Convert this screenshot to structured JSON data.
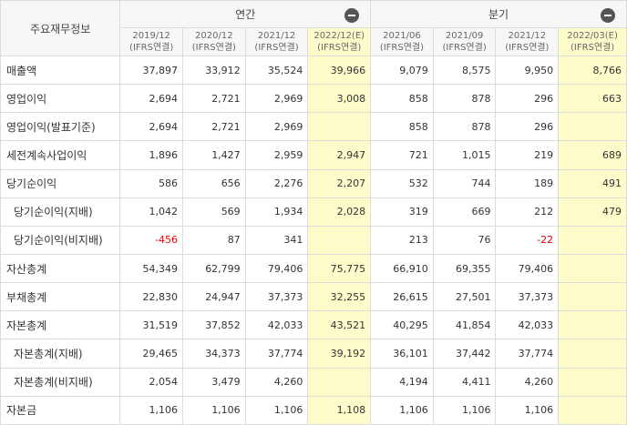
{
  "header": {
    "corner": "주요재무정보",
    "annual_label": "연간",
    "quarter_label": "분기",
    "annual_periods": [
      {
        "date": "2019/12",
        "basis": "(IFRS연결)",
        "estimate": false
      },
      {
        "date": "2020/12",
        "basis": "(IFRS연결)",
        "estimate": false
      },
      {
        "date": "2021/12",
        "basis": "(IFRS연결)",
        "estimate": false
      },
      {
        "date": "2022/12(E)",
        "basis": "(IFRS연결)",
        "estimate": true
      }
    ],
    "quarter_periods": [
      {
        "date": "2021/06",
        "basis": "(IFRS연결)",
        "estimate": false
      },
      {
        "date": "2021/09",
        "basis": "(IFRS연결)",
        "estimate": false
      },
      {
        "date": "2021/12",
        "basis": "(IFRS연결)",
        "estimate": false
      },
      {
        "date": "2022/03(E)",
        "basis": "(IFRS연결)",
        "estimate": true
      }
    ]
  },
  "rows": [
    {
      "label": "매출액",
      "sub": false,
      "values": [
        "37,897",
        "33,912",
        "35,524",
        "39,966",
        "9,079",
        "8,575",
        "9,950",
        "8,766"
      ]
    },
    {
      "label": "영업이익",
      "sub": false,
      "values": [
        "2,694",
        "2,721",
        "2,969",
        "3,008",
        "858",
        "878",
        "296",
        "663"
      ]
    },
    {
      "label": "영업이익(발표기준)",
      "sub": false,
      "values": [
        "2,694",
        "2,721",
        "2,969",
        "",
        "858",
        "878",
        "296",
        ""
      ]
    },
    {
      "label": "세전계속사업이익",
      "sub": false,
      "values": [
        "1,896",
        "1,427",
        "2,959",
        "2,947",
        "721",
        "1,015",
        "219",
        "689"
      ]
    },
    {
      "label": "당기순이익",
      "sub": false,
      "values": [
        "586",
        "656",
        "2,276",
        "2,207",
        "532",
        "744",
        "189",
        "491"
      ]
    },
    {
      "label": "당기순이익(지배)",
      "sub": true,
      "values": [
        "1,042",
        "569",
        "1,934",
        "2,028",
        "319",
        "669",
        "212",
        "479"
      ]
    },
    {
      "label": "당기순이익(비지배)",
      "sub": true,
      "values": [
        "-456",
        "87",
        "341",
        "",
        "213",
        "76",
        "-22",
        ""
      ]
    },
    {
      "label": "자산총계",
      "sub": false,
      "values": [
        "54,349",
        "62,799",
        "79,406",
        "75,775",
        "66,910",
        "69,355",
        "79,406",
        ""
      ]
    },
    {
      "label": "부채총계",
      "sub": false,
      "values": [
        "22,830",
        "24,947",
        "37,373",
        "32,255",
        "26,615",
        "27,501",
        "37,373",
        ""
      ]
    },
    {
      "label": "자본총계",
      "sub": false,
      "values": [
        "31,519",
        "37,852",
        "42,033",
        "43,521",
        "40,295",
        "41,854",
        "42,033",
        ""
      ]
    },
    {
      "label": "자본총계(지배)",
      "sub": true,
      "values": [
        "29,465",
        "34,373",
        "37,774",
        "39,192",
        "36,101",
        "37,442",
        "37,774",
        ""
      ]
    },
    {
      "label": "자본총계(비지배)",
      "sub": true,
      "values": [
        "2,054",
        "3,479",
        "4,260",
        "",
        "4,194",
        "4,411",
        "4,260",
        ""
      ]
    },
    {
      "label": "자본금",
      "sub": false,
      "values": [
        "1,106",
        "1,106",
        "1,106",
        "1,108",
        "1,106",
        "1,106",
        "1,106",
        ""
      ]
    }
  ],
  "colors": {
    "estimate_bg": "#fffccc",
    "negative": "#e00000",
    "header_bg": "#f7f7f7"
  },
  "icons": {
    "annual_toggle": "collapse-minus-icon",
    "quarter_toggle": "collapse-minus-icon"
  }
}
